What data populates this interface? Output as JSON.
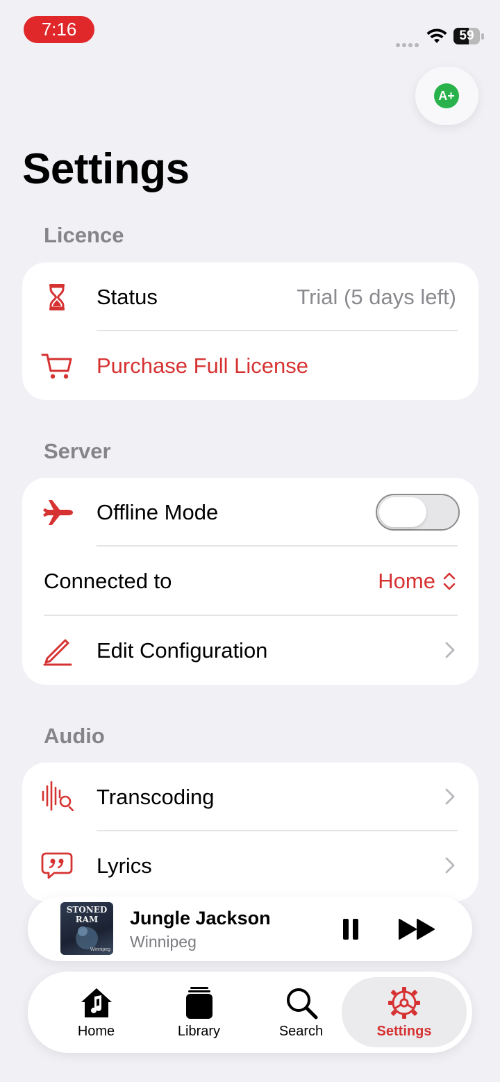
{
  "status_bar": {
    "time": "7:16",
    "battery": "59",
    "battery_level": 0.59
  },
  "avatar": {
    "badge": "A+"
  },
  "page_title": "Settings",
  "licence": {
    "header": "Licence",
    "status_label": "Status",
    "status_value": "Trial (5 days left)",
    "purchase_label": "Purchase Full License"
  },
  "server": {
    "header": "Server",
    "offline_label": "Offline Mode",
    "offline_on": false,
    "connected_label": "Connected to",
    "connected_value": "Home",
    "edit_label": "Edit Configuration"
  },
  "audio": {
    "header": "Audio",
    "transcoding_label": "Transcoding",
    "lyrics_label": "Lyrics"
  },
  "now_playing": {
    "title": "Jungle Jackson",
    "artist": "Winnipeg",
    "art_title": "STONED RAM",
    "art_sub": "Winnipeg"
  },
  "tabs": [
    {
      "label": "Home"
    },
    {
      "label": "Library"
    },
    {
      "label": "Search"
    },
    {
      "label": "Settings"
    }
  ],
  "colors": {
    "accent": "#d63232",
    "background": "#f1f0f5",
    "toggle_off": "#e6e6e8",
    "badge": "#29b24b"
  }
}
